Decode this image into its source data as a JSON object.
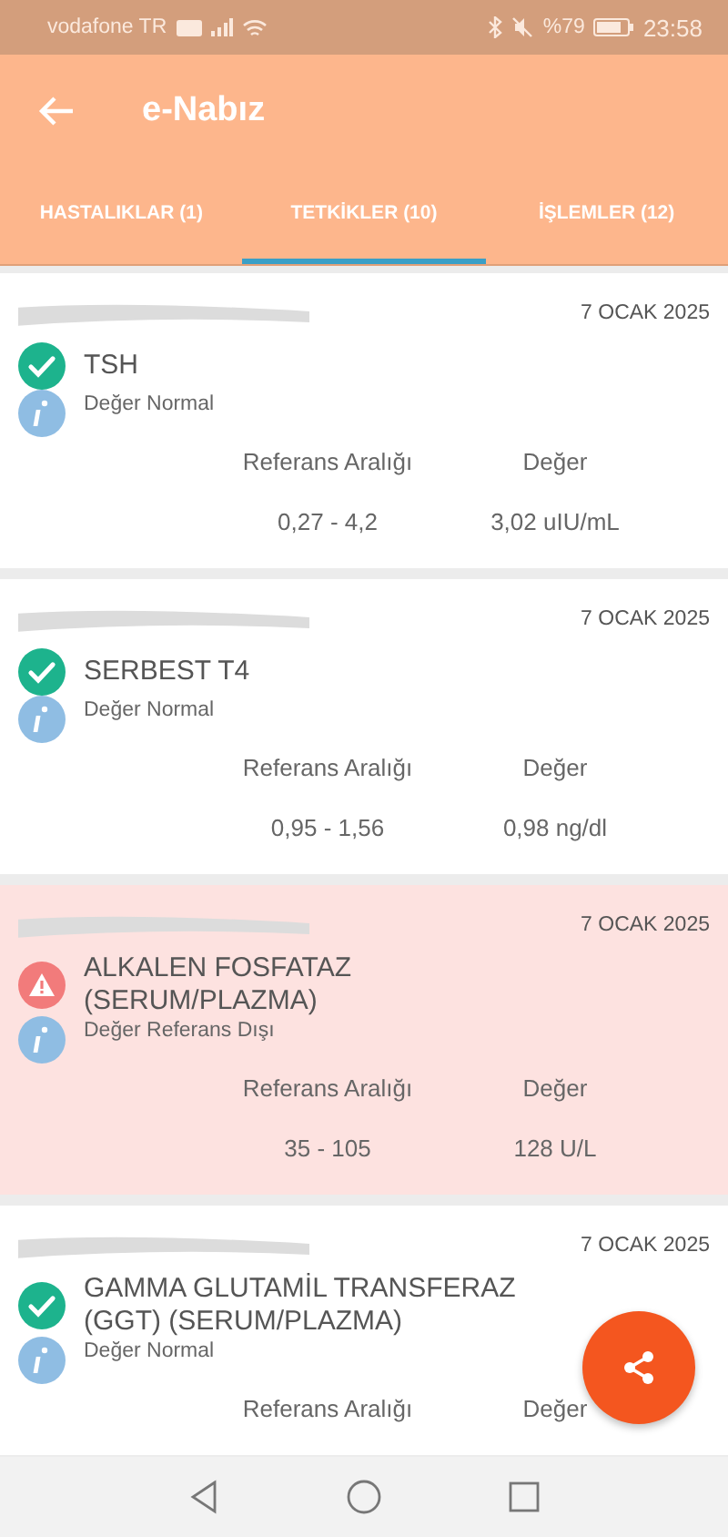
{
  "status_bar": {
    "carrier": "vodafone TR",
    "battery_text": "%79",
    "time": "23:58"
  },
  "app_bar": {
    "title": "e-Nabız"
  },
  "tabs": [
    {
      "label": "HASTALIKLAR (1)",
      "selected": false
    },
    {
      "label": "TETKİKLER (10)",
      "selected": true
    },
    {
      "label": "İŞLEMLER (12)",
      "selected": false
    }
  ],
  "results": [
    {
      "date": "7 OCAK 2025",
      "kind": "normal",
      "name": "TSH",
      "status_text": "Değer Normal",
      "range_header": "Referans Aralığı",
      "value_header": "Değer",
      "range": "0,27 - 4,2",
      "value": "3,02 uIU/mL"
    },
    {
      "date": "7 OCAK 2025",
      "kind": "normal",
      "name": "SERBEST T4",
      "status_text": "Değer Normal",
      "range_header": "Referans Aralığı",
      "value_header": "Değer",
      "range": "0,95 - 1,56",
      "value": "0,98 ng/dl"
    },
    {
      "date": "7 OCAK 2025",
      "kind": "abnormal",
      "name": "ALKALEN FOSFATAZ (SERUM/PLAZMA)",
      "status_text": "Değer Referans Dışı",
      "range_header": "Referans Aralığı",
      "value_header": "Değer",
      "range": "35 - 105",
      "value": "128 U/L"
    },
    {
      "date": "7 OCAK 2025",
      "kind": "normal",
      "name": "GAMMA GLUTAMİL TRANSFERAZ (GGT) (SERUM/PLAZMA)",
      "status_text": "Değer Normal",
      "range_header": "Referans Aralığı",
      "value_header": "Değer"
    }
  ]
}
